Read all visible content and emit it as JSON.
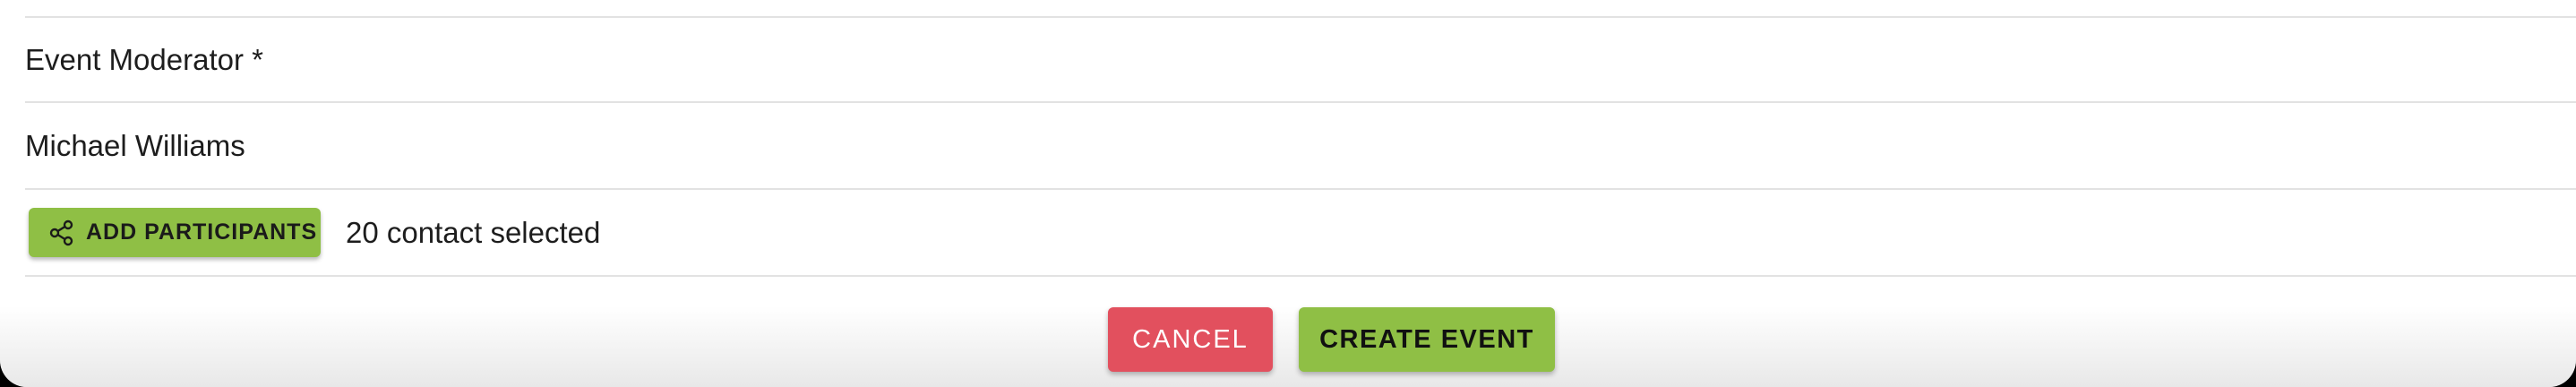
{
  "form": {
    "moderator_label": "Event Moderator *",
    "moderator_value": "Michael Williams",
    "add_participants_label": "ADD PARTICIPANTS",
    "add_participants_icon": "share-icon",
    "selected_count_text": "20 contact selected"
  },
  "actions": {
    "cancel_label": "CANCEL",
    "create_label": "CREATE EVENT"
  },
  "colors": {
    "accent_green": "#8fbf45",
    "cancel_red": "#e2505e",
    "divider": "#e2e2e2"
  }
}
